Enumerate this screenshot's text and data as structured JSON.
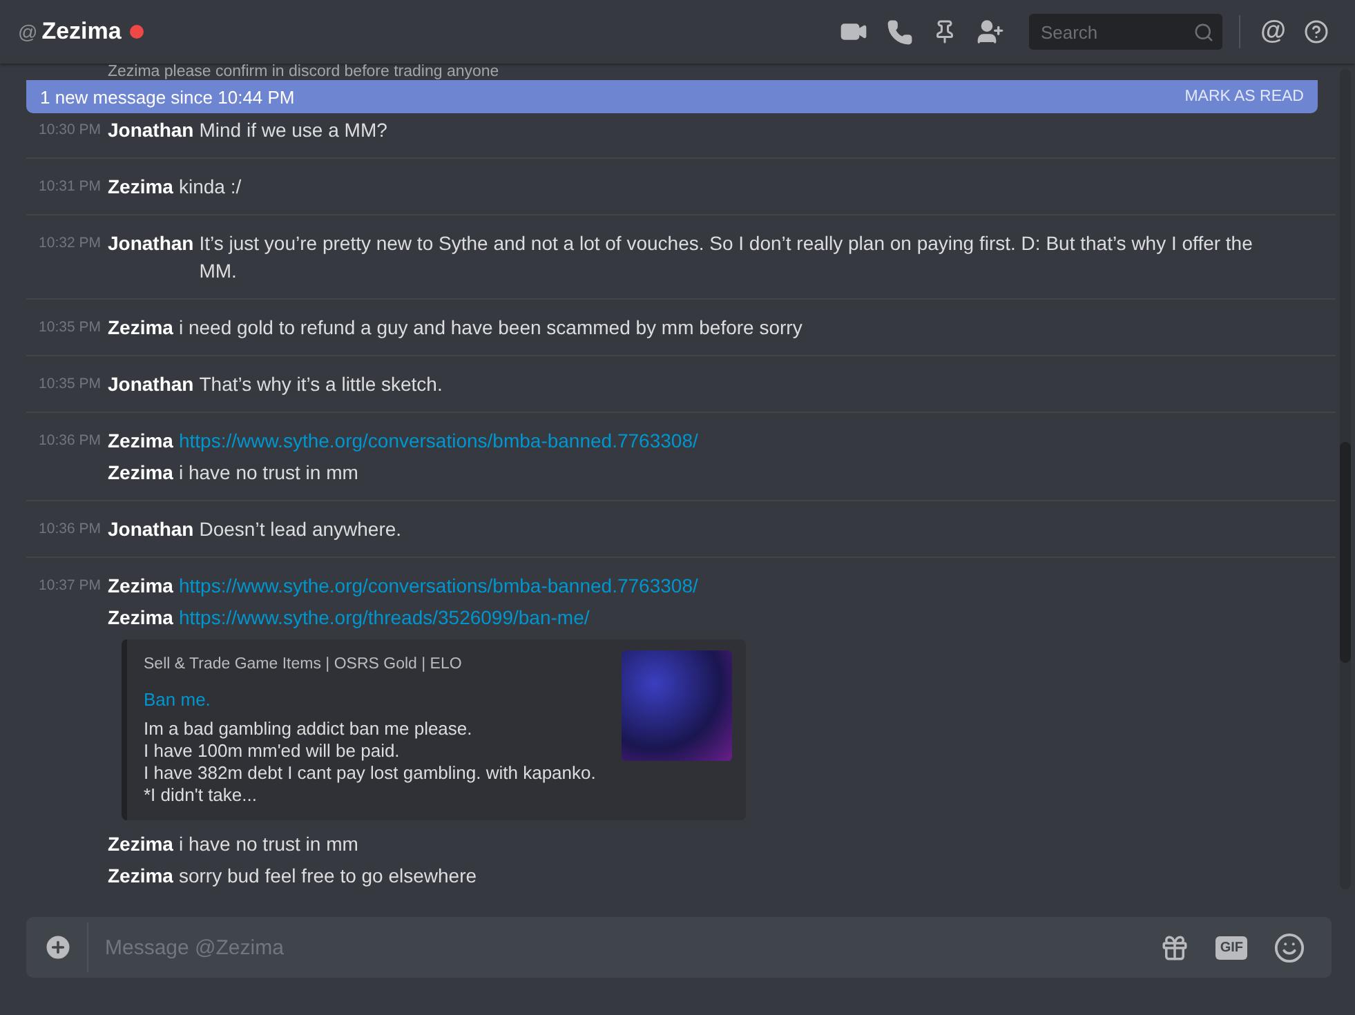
{
  "header": {
    "at_symbol": "@",
    "name": "Zezima",
    "do_not_disturb": true,
    "search": {
      "placeholder": "Search"
    },
    "mention_symbol": "@"
  },
  "hidden_message": {
    "author": "Zezima",
    "text": "please confirm in discord before trading anyone"
  },
  "banner": {
    "text": "1 new message since 10:44 PM",
    "action": "MARK AS READ"
  },
  "groups": [
    {
      "time": "10:30 PM",
      "lines": [
        {
          "author": "Jonathan",
          "kind": "text",
          "text": "Mind if we use a MM?"
        }
      ]
    },
    {
      "time": "10:31 PM",
      "lines": [
        {
          "author": "Zezima",
          "kind": "text",
          "text": "kinda :/"
        }
      ]
    },
    {
      "time": "10:32 PM",
      "lines": [
        {
          "author": "Jonathan",
          "kind": "text",
          "text": "It’s just you’re pretty new to Sythe and not a lot of vouches. So I don’t really plan on paying first. D: But that’s why I offer the MM."
        }
      ]
    },
    {
      "time": "10:35 PM",
      "lines": [
        {
          "author": "Zezima",
          "kind": "text",
          "text": "i need gold to refund a guy and have been scammed by mm before sorry"
        }
      ]
    },
    {
      "time": "10:35 PM",
      "lines": [
        {
          "author": "Jonathan",
          "kind": "text",
          "text": "That’s why it’s a little sketch."
        }
      ]
    },
    {
      "time": "10:36 PM",
      "lines": [
        {
          "author": "Zezima",
          "kind": "link",
          "text": "https://www.sythe.org/conversations/bmba-banned.7763308/"
        },
        {
          "author": "Zezima",
          "kind": "text",
          "text": "i have no trust in mm"
        }
      ]
    },
    {
      "time": "10:36 PM",
      "lines": [
        {
          "author": "Jonathan",
          "kind": "text",
          "text": "Doesn’t lead anywhere."
        }
      ]
    },
    {
      "time": "10:37 PM",
      "lines": [
        {
          "author": "Zezima",
          "kind": "link",
          "text": "https://www.sythe.org/conversations/bmba-banned.7763308/"
        },
        {
          "author": "Zezima",
          "kind": "link",
          "text": "https://www.sythe.org/threads/3526099/ban-me/",
          "embed": {
            "provider": "Sell & Trade Game Items | OSRS Gold | ELO",
            "title": "Ban me.",
            "description": [
              "Im a bad gambling addict ban me please.",
              "I have 100m mm'ed will be paid.",
              "I have 382m debt I cant pay lost gambling. with kapanko.",
              "*I didn't take..."
            ]
          }
        },
        {
          "author": "Zezima",
          "kind": "text",
          "text": "i have no trust in mm"
        },
        {
          "author": "Zezima",
          "kind": "text",
          "text": "sorry bud feel free to go elsewhere"
        }
      ]
    }
  ],
  "composer": {
    "placeholder": "Message @Zezima",
    "gif_label": "GIF"
  }
}
